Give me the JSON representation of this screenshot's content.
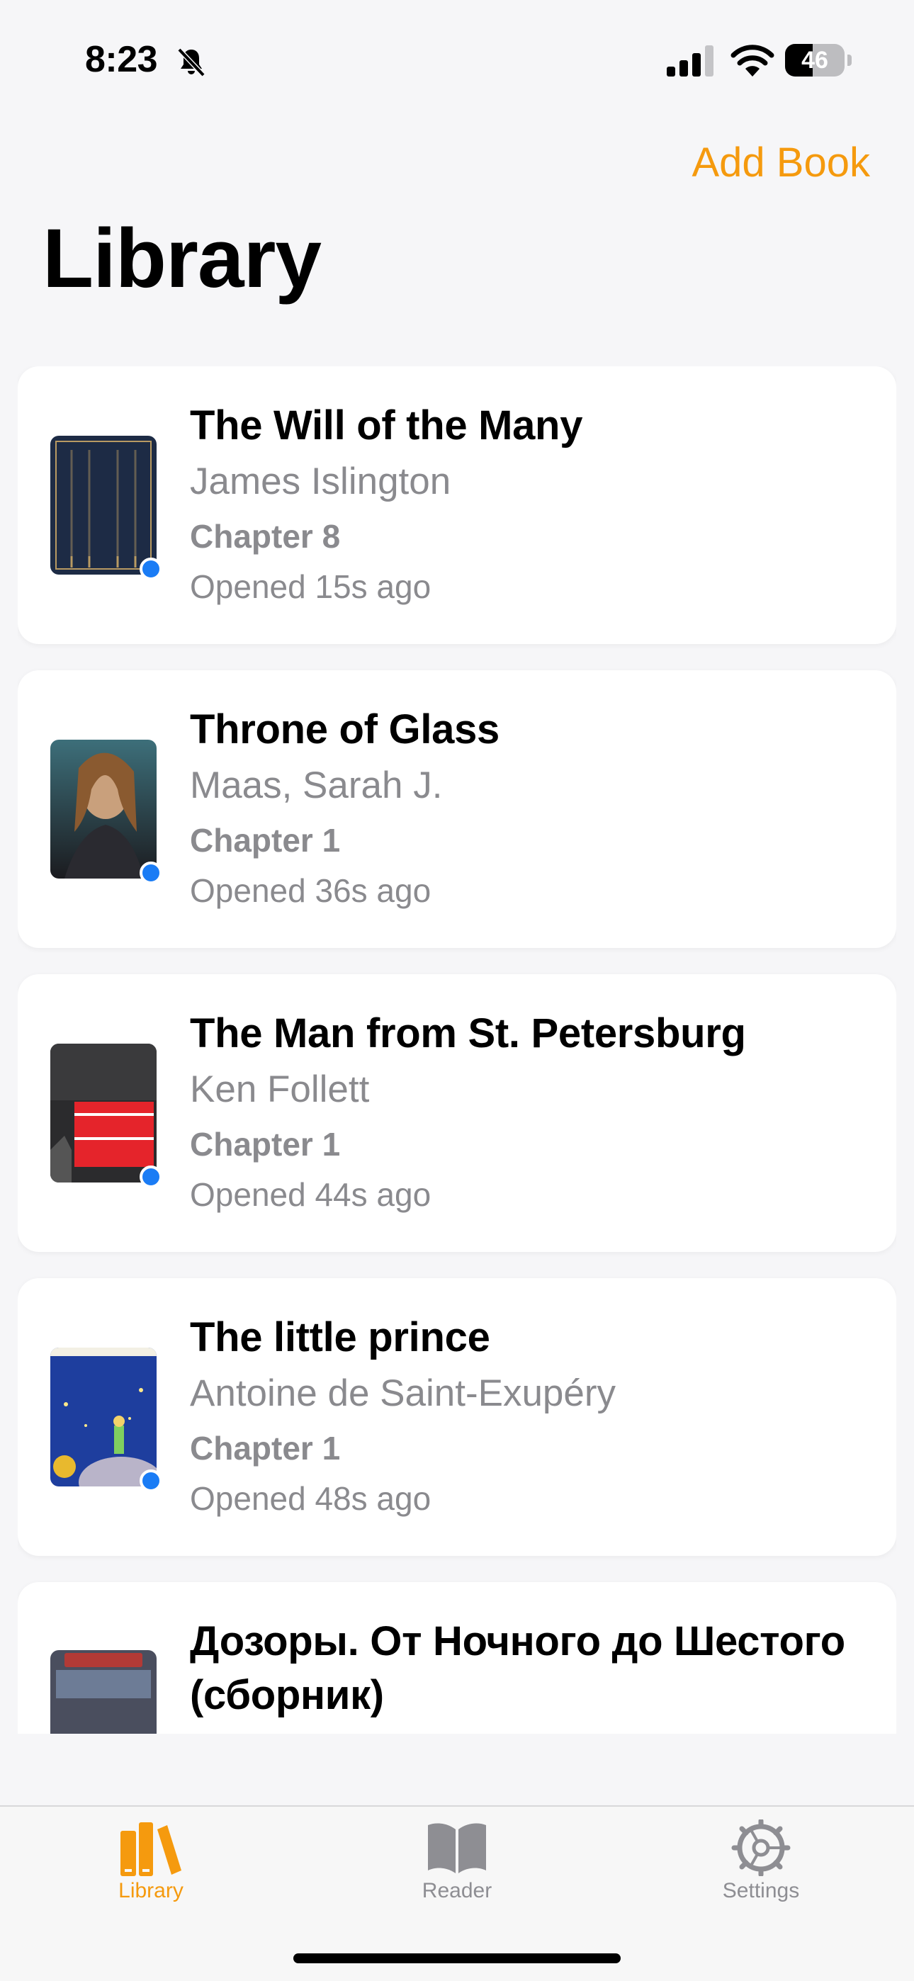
{
  "status_bar": {
    "time": "8:23",
    "battery_level": "46",
    "icons": [
      "bell-slash-icon",
      "cellular-signal-icon",
      "wifi-icon",
      "battery-icon"
    ]
  },
  "nav": {
    "add_book_label": "Add Book",
    "title": "Library"
  },
  "colors": {
    "accent": "#f59a0e",
    "unread_dot": "#1a7cf5",
    "secondary_text": "#8a8a8e"
  },
  "books": [
    {
      "title": "The Will of the Many",
      "author": "James Islington",
      "chapter": "Chapter 8",
      "opened": "Opened 15s ago",
      "unread": true
    },
    {
      "title": "Throne of Glass",
      "author": "Maas, Sarah J.",
      "chapter": "Chapter 1",
      "opened": "Opened 36s ago",
      "unread": true
    },
    {
      "title": "The Man from St. Petersburg",
      "author": "Ken Follett",
      "chapter": "Chapter 1",
      "opened": "Opened 44s ago",
      "unread": true
    },
    {
      "title": "The little prince",
      "author": "Antoine de Saint-Exupéry",
      "chapter": "Chapter 1",
      "opened": "Opened 48s ago",
      "unread": true
    },
    {
      "title": "Дозоры. От Ночного до Шестого (сборник)"
    }
  ],
  "tab_bar": {
    "tabs": [
      {
        "label": "Library",
        "icon": "books-icon",
        "selected": true
      },
      {
        "label": "Reader",
        "icon": "open-book-icon",
        "selected": false
      },
      {
        "label": "Settings",
        "icon": "gear-icon",
        "selected": false
      }
    ]
  }
}
